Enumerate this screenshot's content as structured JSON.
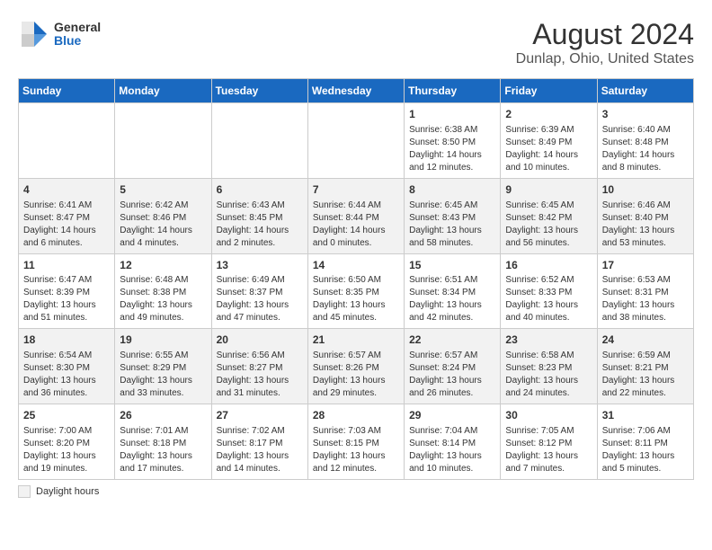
{
  "logo": {
    "general": "General",
    "blue": "Blue"
  },
  "title": "August 2024",
  "subtitle": "Dunlap, Ohio, United States",
  "days_of_week": [
    "Sunday",
    "Monday",
    "Tuesday",
    "Wednesday",
    "Thursday",
    "Friday",
    "Saturday"
  ],
  "footer": {
    "legend_label": "Daylight hours"
  },
  "weeks": [
    [
      {
        "day": "",
        "info": ""
      },
      {
        "day": "",
        "info": ""
      },
      {
        "day": "",
        "info": ""
      },
      {
        "day": "",
        "info": ""
      },
      {
        "day": "1",
        "info": "Sunrise: 6:38 AM\nSunset: 8:50 PM\nDaylight: 14 hours and 12 minutes."
      },
      {
        "day": "2",
        "info": "Sunrise: 6:39 AM\nSunset: 8:49 PM\nDaylight: 14 hours and 10 minutes."
      },
      {
        "day": "3",
        "info": "Sunrise: 6:40 AM\nSunset: 8:48 PM\nDaylight: 14 hours and 8 minutes."
      }
    ],
    [
      {
        "day": "4",
        "info": "Sunrise: 6:41 AM\nSunset: 8:47 PM\nDaylight: 14 hours and 6 minutes."
      },
      {
        "day": "5",
        "info": "Sunrise: 6:42 AM\nSunset: 8:46 PM\nDaylight: 14 hours and 4 minutes."
      },
      {
        "day": "6",
        "info": "Sunrise: 6:43 AM\nSunset: 8:45 PM\nDaylight: 14 hours and 2 minutes."
      },
      {
        "day": "7",
        "info": "Sunrise: 6:44 AM\nSunset: 8:44 PM\nDaylight: 14 hours and 0 minutes."
      },
      {
        "day": "8",
        "info": "Sunrise: 6:45 AM\nSunset: 8:43 PM\nDaylight: 13 hours and 58 minutes."
      },
      {
        "day": "9",
        "info": "Sunrise: 6:45 AM\nSunset: 8:42 PM\nDaylight: 13 hours and 56 minutes."
      },
      {
        "day": "10",
        "info": "Sunrise: 6:46 AM\nSunset: 8:40 PM\nDaylight: 13 hours and 53 minutes."
      }
    ],
    [
      {
        "day": "11",
        "info": "Sunrise: 6:47 AM\nSunset: 8:39 PM\nDaylight: 13 hours and 51 minutes."
      },
      {
        "day": "12",
        "info": "Sunrise: 6:48 AM\nSunset: 8:38 PM\nDaylight: 13 hours and 49 minutes."
      },
      {
        "day": "13",
        "info": "Sunrise: 6:49 AM\nSunset: 8:37 PM\nDaylight: 13 hours and 47 minutes."
      },
      {
        "day": "14",
        "info": "Sunrise: 6:50 AM\nSunset: 8:35 PM\nDaylight: 13 hours and 45 minutes."
      },
      {
        "day": "15",
        "info": "Sunrise: 6:51 AM\nSunset: 8:34 PM\nDaylight: 13 hours and 42 minutes."
      },
      {
        "day": "16",
        "info": "Sunrise: 6:52 AM\nSunset: 8:33 PM\nDaylight: 13 hours and 40 minutes."
      },
      {
        "day": "17",
        "info": "Sunrise: 6:53 AM\nSunset: 8:31 PM\nDaylight: 13 hours and 38 minutes."
      }
    ],
    [
      {
        "day": "18",
        "info": "Sunrise: 6:54 AM\nSunset: 8:30 PM\nDaylight: 13 hours and 36 minutes."
      },
      {
        "day": "19",
        "info": "Sunrise: 6:55 AM\nSunset: 8:29 PM\nDaylight: 13 hours and 33 minutes."
      },
      {
        "day": "20",
        "info": "Sunrise: 6:56 AM\nSunset: 8:27 PM\nDaylight: 13 hours and 31 minutes."
      },
      {
        "day": "21",
        "info": "Sunrise: 6:57 AM\nSunset: 8:26 PM\nDaylight: 13 hours and 29 minutes."
      },
      {
        "day": "22",
        "info": "Sunrise: 6:57 AM\nSunset: 8:24 PM\nDaylight: 13 hours and 26 minutes."
      },
      {
        "day": "23",
        "info": "Sunrise: 6:58 AM\nSunset: 8:23 PM\nDaylight: 13 hours and 24 minutes."
      },
      {
        "day": "24",
        "info": "Sunrise: 6:59 AM\nSunset: 8:21 PM\nDaylight: 13 hours and 22 minutes."
      }
    ],
    [
      {
        "day": "25",
        "info": "Sunrise: 7:00 AM\nSunset: 8:20 PM\nDaylight: 13 hours and 19 minutes."
      },
      {
        "day": "26",
        "info": "Sunrise: 7:01 AM\nSunset: 8:18 PM\nDaylight: 13 hours and 17 minutes."
      },
      {
        "day": "27",
        "info": "Sunrise: 7:02 AM\nSunset: 8:17 PM\nDaylight: 13 hours and 14 minutes."
      },
      {
        "day": "28",
        "info": "Sunrise: 7:03 AM\nSunset: 8:15 PM\nDaylight: 13 hours and 12 minutes."
      },
      {
        "day": "29",
        "info": "Sunrise: 7:04 AM\nSunset: 8:14 PM\nDaylight: 13 hours and 10 minutes."
      },
      {
        "day": "30",
        "info": "Sunrise: 7:05 AM\nSunset: 8:12 PM\nDaylight: 13 hours and 7 minutes."
      },
      {
        "day": "31",
        "info": "Sunrise: 7:06 AM\nSunset: 8:11 PM\nDaylight: 13 hours and 5 minutes."
      }
    ]
  ]
}
